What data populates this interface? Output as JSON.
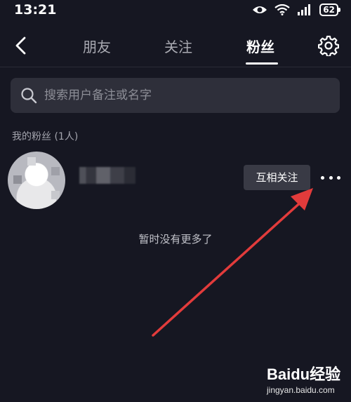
{
  "status_bar": {
    "time": "13:21",
    "battery": "62"
  },
  "nav": {
    "tabs": [
      {
        "label": "朋友"
      },
      {
        "label": "关注"
      },
      {
        "label": "粉丝"
      }
    ],
    "active_tab": "粉丝"
  },
  "search": {
    "placeholder": "搜索用户备注或名字",
    "value": ""
  },
  "followers": {
    "section_title": "我的粉丝 (1人)",
    "items": [
      {
        "action_label": "互相关注"
      }
    ],
    "empty_text": "暂时没有更多了"
  },
  "watermark": {
    "logo": "Baidu经验",
    "url": "jingyan.baidu.com"
  },
  "colors": {
    "background": "#161722",
    "search_bg": "#2e2f3a",
    "button_bg": "#393a45",
    "annotation_arrow": "#e23b3b"
  },
  "icons": [
    "back-icon",
    "gear-icon",
    "search-icon",
    "more-icon",
    "eye-icon",
    "wifi-icon",
    "signal-icon",
    "battery-icon"
  ]
}
